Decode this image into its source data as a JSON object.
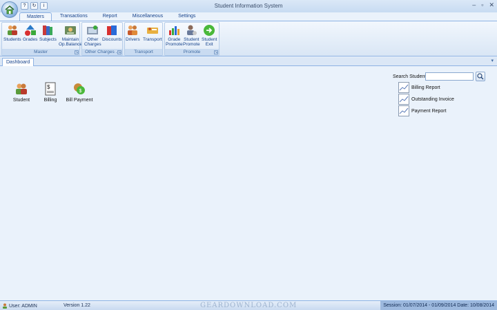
{
  "window": {
    "title": "Student Information System",
    "controls": [
      "–",
      "▫",
      "✕"
    ]
  },
  "qat": [
    "?",
    "↻",
    "i"
  ],
  "tabs": [
    "Masters",
    "Transactions",
    "Report",
    "Miscellaneous",
    "Settings"
  ],
  "groups": {
    "master": {
      "label": "Master",
      "buttons": [
        "Students",
        "Grades",
        "Subjects",
        "Maintain\nOp.Balance"
      ]
    },
    "other_charges": {
      "label": "Other Charges ...",
      "buttons": [
        "Other\nCharges",
        "Discounts"
      ]
    },
    "transport": {
      "label": "Transport",
      "buttons": [
        "Drivers",
        "Transport"
      ]
    },
    "promote": {
      "label": "Promote",
      "buttons": [
        "Grade\nPromote",
        "Student\nPromote",
        "Student\nExit"
      ]
    }
  },
  "doc_tab": "Dashboard",
  "dashboard": {
    "items": [
      "Student",
      "Billing",
      "Bill Payment"
    ]
  },
  "search": {
    "label": "Search Student",
    "value": "",
    "placeholder": ""
  },
  "reports": [
    "Billing Report",
    "Outstanding Invoice",
    "Payment Report"
  ],
  "status": {
    "user": "User:  ADMIN",
    "version": "Version 1.22",
    "watermark": "GEARDOWNLOAD.COM",
    "session": "Session:  01/07/2014 - 01/09/2014  Date:  10/08/2014"
  },
  "colors": {
    "accent": "#15428b",
    "ribbon_border": "#8db2e3",
    "workspace": "#eaf2fb"
  }
}
